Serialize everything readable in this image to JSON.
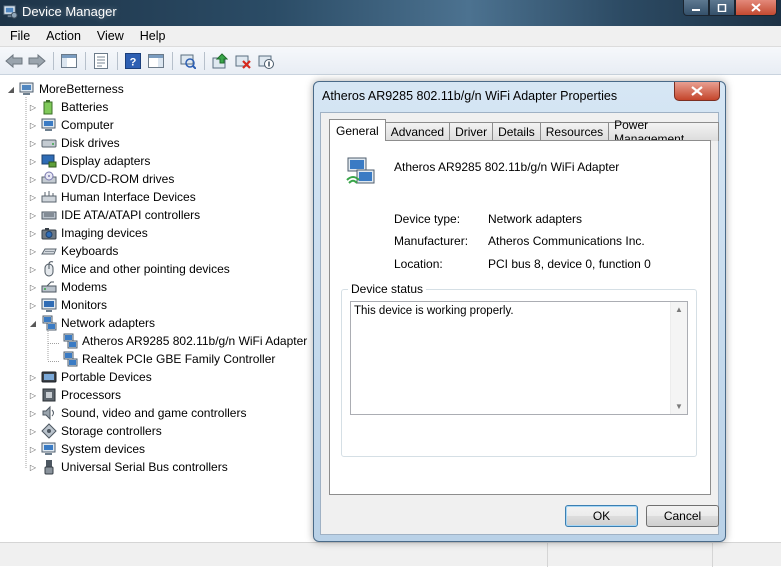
{
  "window": {
    "title": "Device Manager"
  },
  "menu": [
    "File",
    "Action",
    "View",
    "Help"
  ],
  "toolbar_icons": [
    "back-arrow-icon",
    "forward-arrow-icon",
    "show-hide-tree-icon",
    "properties-icon",
    "help-icon",
    "action-pane-icon",
    "scan-hardware-icon",
    "update-driver-icon",
    "uninstall-icon",
    "disable-device-icon"
  ],
  "tree": {
    "root": "MoreBetterness",
    "categories": [
      {
        "label": "Batteries",
        "icon": "battery-icon"
      },
      {
        "label": "Computer",
        "icon": "computer-icon"
      },
      {
        "label": "Disk drives",
        "icon": "disk-drive-icon"
      },
      {
        "label": "Display adapters",
        "icon": "display-adapter-icon"
      },
      {
        "label": "DVD/CD-ROM drives",
        "icon": "dvd-drive-icon"
      },
      {
        "label": "Human Interface Devices",
        "icon": "hid-icon"
      },
      {
        "label": "IDE ATA/ATAPI controllers",
        "icon": "ide-controller-icon"
      },
      {
        "label": "Imaging devices",
        "icon": "camera-icon"
      },
      {
        "label": "Keyboards",
        "icon": "keyboard-icon"
      },
      {
        "label": "Mice and other pointing devices",
        "icon": "mouse-icon"
      },
      {
        "label": "Modems",
        "icon": "modem-icon"
      },
      {
        "label": "Monitors",
        "icon": "monitor-icon"
      },
      {
        "label": "Network adapters",
        "icon": "network-adapter-icon",
        "expanded": true,
        "children": [
          "Atheros AR9285 802.11b/g/n WiFi Adapter",
          "Realtek PCIe GBE Family Controller"
        ]
      },
      {
        "label": "Portable Devices",
        "icon": "portable-device-icon"
      },
      {
        "label": "Processors",
        "icon": "processor-icon"
      },
      {
        "label": "Sound, video and game controllers",
        "icon": "speaker-icon"
      },
      {
        "label": "Storage controllers",
        "icon": "storage-controller-icon"
      },
      {
        "label": "System devices",
        "icon": "system-device-icon"
      },
      {
        "label": "Universal Serial Bus controllers",
        "icon": "usb-icon"
      }
    ]
  },
  "dialog": {
    "title": "Atheros AR9285 802.11b/g/n WiFi Adapter Properties",
    "tabs": [
      "General",
      "Advanced",
      "Driver",
      "Details",
      "Resources",
      "Power Management"
    ],
    "active_tab": "General",
    "device_name": "Atheros AR9285 802.11b/g/n WiFi Adapter",
    "properties": [
      {
        "label": "Device type:",
        "value": "Network adapters"
      },
      {
        "label": "Manufacturer:",
        "value": "Atheros Communications Inc."
      },
      {
        "label": "Location:",
        "value": "PCI bus 8, device 0, function 0"
      }
    ],
    "status_group_label": "Device status",
    "status_text": "This device is working properly.",
    "ok_label": "OK",
    "cancel_label": "Cancel"
  },
  "colors": {
    "titlebar": "#2b4c66",
    "dialog_frame": "#b9d1e7",
    "close_button": "#c4452b",
    "tree_lines": "#a0a0a0"
  }
}
